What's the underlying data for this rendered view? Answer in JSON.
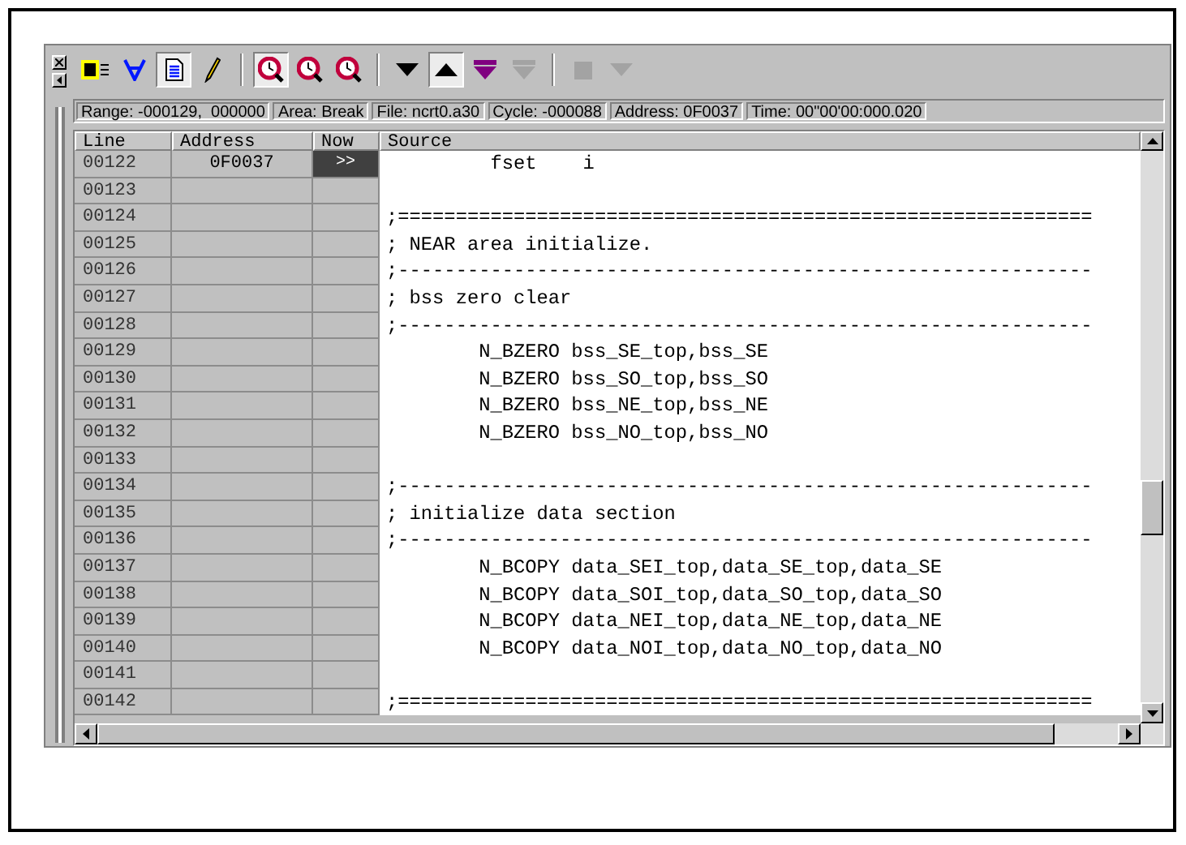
{
  "toolbar": {
    "tools": [
      {
        "kind": "chip",
        "pressed": false,
        "disabled": false
      },
      {
        "kind": "forall",
        "pressed": false,
        "disabled": false
      },
      {
        "kind": "document",
        "pressed": true,
        "disabled": false
      },
      {
        "kind": "pencil",
        "pressed": false,
        "disabled": false
      },
      {
        "kind": "separator"
      },
      {
        "kind": "clock-search",
        "pressed": true,
        "disabled": false
      },
      {
        "kind": "clock-search",
        "pressed": false,
        "disabled": false
      },
      {
        "kind": "clock-search",
        "pressed": false,
        "disabled": false
      },
      {
        "kind": "separator"
      },
      {
        "kind": "down",
        "pressed": false,
        "disabled": false
      },
      {
        "kind": "up",
        "pressed": true,
        "disabled": false
      },
      {
        "kind": "down-bar",
        "pressed": false,
        "disabled": false
      },
      {
        "kind": "down-bar",
        "pressed": false,
        "disabled": true
      },
      {
        "kind": "separator"
      },
      {
        "kind": "square",
        "pressed": false,
        "disabled": true
      },
      {
        "kind": "down",
        "pressed": false,
        "disabled": true
      }
    ]
  },
  "status_bar": [
    "Range: -000129,  000000",
    "Area: Break",
    "File: ncrt0.a30",
    "Cycle: -000088",
    "Address: 0F0037",
    "Time: 00\"00'00:000.020"
  ],
  "table": {
    "columns": [
      "Line",
      "Address",
      "Now",
      "Source"
    ],
    "rows": [
      {
        "line": "00122",
        "address": "0F0037",
        "now": ">>",
        "current": true,
        "source": "         fset    i"
      },
      {
        "line": "00123",
        "current": false
      },
      {
        "line": "00124",
        "current": false,
        "source": ";============================================================"
      },
      {
        "line": "00125",
        "current": false,
        "source": "; NEAR area initialize."
      },
      {
        "line": "00126",
        "current": false,
        "source": ";------------------------------------------------------------"
      },
      {
        "line": "00127",
        "current": false,
        "source": "; bss zero clear"
      },
      {
        "line": "00128",
        "current": false,
        "source": ";------------------------------------------------------------"
      },
      {
        "line": "00129",
        "current": false,
        "source": "        N_BZERO bss_SE_top,bss_SE"
      },
      {
        "line": "00130",
        "current": false,
        "source": "        N_BZERO bss_SO_top,bss_SO"
      },
      {
        "line": "00131",
        "current": false,
        "source": "        N_BZERO bss_NE_top,bss_NE"
      },
      {
        "line": "00132",
        "current": false,
        "source": "        N_BZERO bss_NO_top,bss_NO"
      },
      {
        "line": "00133",
        "current": false
      },
      {
        "line": "00134",
        "current": false,
        "source": ";------------------------------------------------------------"
      },
      {
        "line": "00135",
        "current": false,
        "source": "; initialize data section"
      },
      {
        "line": "00136",
        "current": false,
        "source": ";------------------------------------------------------------"
      },
      {
        "line": "00137",
        "current": false,
        "source": "        N_BCOPY data_SEI_top,data_SE_top,data_SE"
      },
      {
        "line": "00138",
        "current": false,
        "source": "        N_BCOPY data_SOI_top,data_SO_top,data_SO"
      },
      {
        "line": "00139",
        "current": false,
        "source": "        N_BCOPY data_NEI_top,data_NE_top,data_NE"
      },
      {
        "line": "00140",
        "current": false,
        "source": "        N_BCOPY data_NOI_top,data_NO_top,data_NO"
      },
      {
        "line": "00141",
        "current": false
      },
      {
        "line": "00142",
        "current": false,
        "source": ";============================================================"
      }
    ]
  }
}
